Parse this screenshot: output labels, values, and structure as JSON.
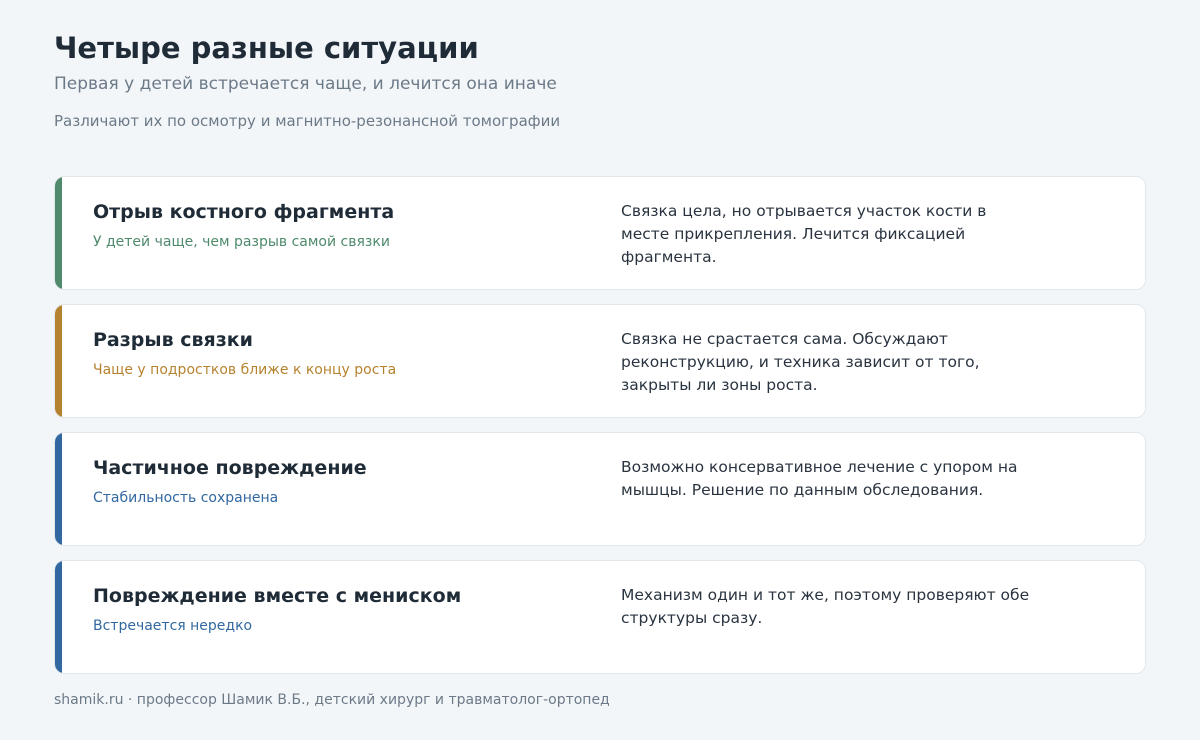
{
  "header": {
    "title": "Четыре разные ситуации",
    "subtitle": "Первая у детей встречается чаще, и лечится она иначе",
    "note": "Различают их по осмотру и магнитно-резонансной томографии"
  },
  "colors": {
    "green": "#4e8a6b",
    "amber": "#b5832f",
    "blue": "#3268a0"
  },
  "cards": [
    {
      "title": "Отрыв костного фрагмента",
      "tag": "У детей чаще, чем разрыв самой связки",
      "description": "Связка цела, но отрывается участок кости в месте прикрепления. Лечится фиксацией фрагмента.",
      "color": "#4e8a6b"
    },
    {
      "title": "Разрыв связки",
      "tag": "Чаще у подростков ближе к концу роста",
      "description": "Связка не срастается сама. Обсуждают реконструкцию, и техника зависит от того, закрыты ли зоны роста.",
      "color": "#b5832f"
    },
    {
      "title": "Частичное повреждение",
      "tag": "Стабильность сохранена",
      "description": "Возможно консервативное лечение с упором на мышцы. Решение по данным обследования.",
      "color": "#3268a0"
    },
    {
      "title": "Повреждение вместе с мениском",
      "tag": "Встречается нередко",
      "description": "Механизм один и тот же, поэтому проверяют обе структуры сразу.",
      "color": "#3268a0"
    }
  ],
  "footer": {
    "text": "shamik.ru · профессор Шамик В.Б., детский хирург и травматолог-ортопед"
  }
}
